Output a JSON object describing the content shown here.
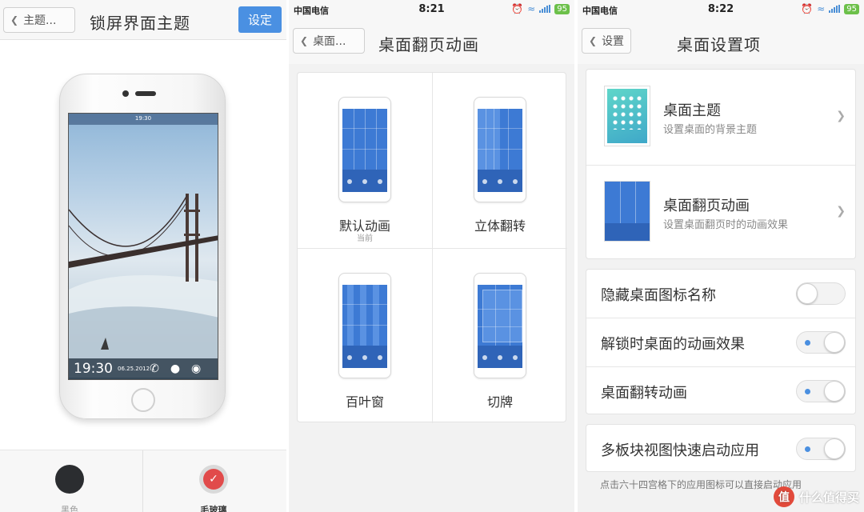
{
  "panel1": {
    "back_label": "主题...",
    "title": "锁屏界面主题",
    "set_button": "设定",
    "phone_screen": {
      "time": "19:30",
      "clock_small": "19:30",
      "date": "06.25.2012"
    },
    "swatches": [
      {
        "label": "黑色",
        "color": "#2b2d30",
        "selected": false
      },
      {
        "label": "毛玻璃",
        "color": "#e14b4b",
        "selected": true
      }
    ]
  },
  "panel2": {
    "status": {
      "carrier": "中国电信",
      "time": "8:21",
      "battery": "95"
    },
    "back_label": "桌面...",
    "title": "桌面翻页动画",
    "animations": [
      {
        "name": "默认动画",
        "sub": "当前"
      },
      {
        "name": "立体翻转",
        "sub": ""
      },
      {
        "name": "百叶窗",
        "sub": ""
      },
      {
        "name": "切牌",
        "sub": ""
      }
    ]
  },
  "panel3": {
    "status": {
      "carrier": "中国电信",
      "time": "8:22",
      "battery": "95"
    },
    "back_label": "设置",
    "title": "桌面设置项",
    "items": [
      {
        "title": "桌面主题",
        "sub": "设置桌面的背景主题"
      },
      {
        "title": "桌面翻页动画",
        "sub": "设置桌面翻页时的动画效果"
      }
    ],
    "toggles": [
      {
        "label": "隐藏桌面图标名称",
        "on": false
      },
      {
        "label": "解锁时桌面的动画效果",
        "on": true
      },
      {
        "label": "桌面翻转动画",
        "on": true
      }
    ],
    "toggle_extra": {
      "label": "多板块视图快速启动应用",
      "on": true
    },
    "hint": "点击六十四宫格下的应用图标可以直接启动应用",
    "watermark": "什么值得买",
    "watermark_logo": "值"
  },
  "colors": {
    "accent": "#4a90e2",
    "toggle_indicator": "#4a8fe0",
    "tile_blue": "#3d7ad4"
  }
}
